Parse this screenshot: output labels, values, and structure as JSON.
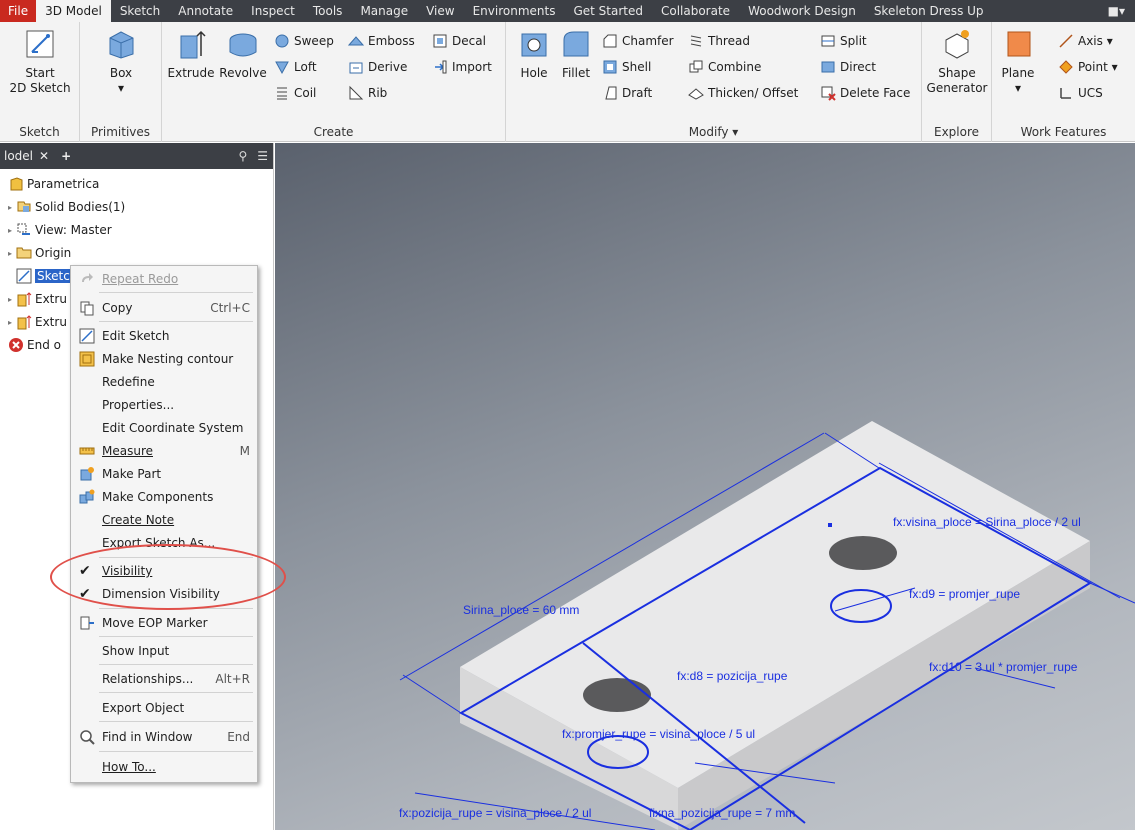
{
  "tabs": [
    "File",
    "3D Model",
    "Sketch",
    "Annotate",
    "Inspect",
    "Tools",
    "Manage",
    "View",
    "Environments",
    "Get Started",
    "Collaborate",
    "Woodwork Design",
    "Skeleton Dress Up"
  ],
  "active_tab": "3D Model",
  "ribbon": {
    "sketch": {
      "label": "Sketch",
      "start_line1": "Start",
      "start_line2": "2D Sketch"
    },
    "primitives": {
      "label": "Primitives",
      "box": "Box"
    },
    "create": {
      "label": "Create",
      "extrude": "Extrude",
      "revolve": "Revolve",
      "sweep": "Sweep",
      "loft": "Loft",
      "coil": "Coil",
      "emboss": "Emboss",
      "derive": "Derive",
      "rib": "Rib",
      "decal": "Decal",
      "import": "Import"
    },
    "modify": {
      "label": "Modify",
      "hole": "Hole",
      "fillet": "Fillet",
      "chamfer": "Chamfer",
      "shell": "Shell",
      "draft": "Draft",
      "thread": "Thread",
      "combine": "Combine",
      "thicken": "Thicken/ Offset",
      "split": "Split",
      "direct": "Direct",
      "delete_face": "Delete Face"
    },
    "explore": {
      "label": "Explore",
      "shape_gen1": "Shape",
      "shape_gen2": "Generator"
    },
    "work_features": {
      "label": "Work Features",
      "plane": "Plane",
      "axis": "Axis",
      "point": "Point",
      "ucs": "UCS"
    }
  },
  "browser": {
    "title": "lodel",
    "items": [
      "Parametrica",
      "Solid Bodies(1)",
      "View: Master",
      "Origin",
      "Sketc",
      "Extru",
      "Extru",
      "End o"
    ]
  },
  "context_menu": {
    "items": [
      {
        "label": "Repeat Redo",
        "shortcut": ""
      },
      {
        "label": "Copy",
        "shortcut": "Ctrl+C"
      },
      {
        "label": "Edit Sketch",
        "shortcut": ""
      },
      {
        "label": "Make Nesting contour",
        "shortcut": ""
      },
      {
        "label": "Redefine",
        "shortcut": ""
      },
      {
        "label": "Properties...",
        "shortcut": ""
      },
      {
        "label": "Edit Coordinate System",
        "shortcut": ""
      },
      {
        "label": "Measure",
        "shortcut": "M"
      },
      {
        "label": "Make Part",
        "shortcut": ""
      },
      {
        "label": "Make Components",
        "shortcut": ""
      },
      {
        "label": "Create Note",
        "shortcut": ""
      },
      {
        "label": "Export Sketch As...",
        "shortcut": ""
      },
      {
        "label": "Visibility",
        "shortcut": ""
      },
      {
        "label": "Dimension Visibility",
        "shortcut": ""
      },
      {
        "label": "Move EOP Marker",
        "shortcut": ""
      },
      {
        "label": "Show Input",
        "shortcut": ""
      },
      {
        "label": "Relationships...",
        "shortcut": "Alt+R"
      },
      {
        "label": "Export Object",
        "shortcut": ""
      },
      {
        "label": "Find in Window",
        "shortcut": "End"
      },
      {
        "label": "How To...",
        "shortcut": ""
      }
    ]
  },
  "dimensions": {
    "sirina": "Sirina_ploce = 60 mm",
    "visina": "fx:visina_ploce = Sirina_ploce / 2 ul",
    "d9": "fx:d9 = promjer_rupe",
    "d10": "fx:d10 = 3 ul * promjer_rupe",
    "d8": "fx:d8 = pozicija_rupe",
    "promjer": "fx:promjer_rupe = visina_ploce / 5 ul",
    "pozicija": "fx:pozicija_rupe = visina_ploce / 2 ul",
    "fiksna": "fixna_pozicija_rupe = 7 mm"
  },
  "colors": {
    "accent": "#c9291f",
    "selection": "#2b65c8",
    "dimension": "#1a2fe0",
    "highlight": "#e0504a"
  }
}
